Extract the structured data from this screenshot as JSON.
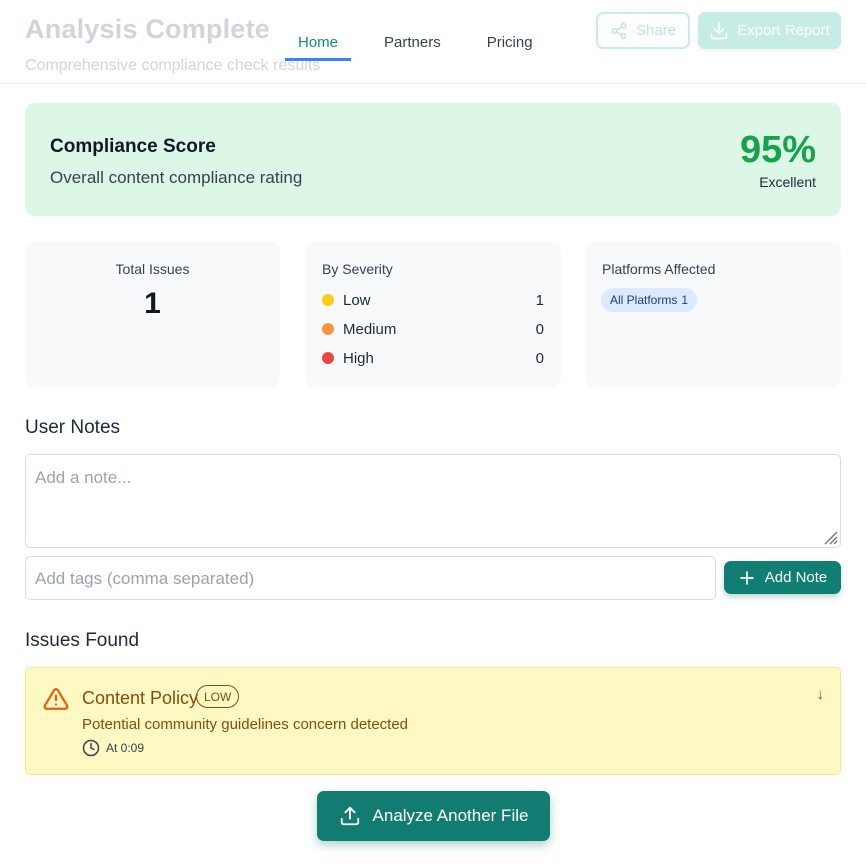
{
  "header": {
    "title": "Analysis Complete",
    "subtitle": "Comprehensive compliance check results",
    "nav": [
      {
        "label": "Home",
        "active": true
      },
      {
        "label": "Partners",
        "active": false
      },
      {
        "label": "Pricing",
        "active": false
      }
    ],
    "share_label": "Share",
    "share_icon": "share-icon",
    "export_label": "Export Report",
    "export_icon": "download-icon"
  },
  "score": {
    "title": "Compliance Score",
    "description": "Overall content compliance rating",
    "value": "95%",
    "rating": "Excellent"
  },
  "stats": {
    "total": {
      "label": "Total Issues",
      "value": "1"
    },
    "severity": {
      "label": "By Severity",
      "items": [
        {
          "name": "Low",
          "count": "1",
          "color": "#facc15"
        },
        {
          "name": "Medium",
          "count": "0",
          "color": "#fb923c"
        },
        {
          "name": "High",
          "count": "0",
          "color": "#ef4444"
        }
      ]
    },
    "platforms": {
      "label": "Platforms Affected",
      "badge_name": "All Platforms",
      "badge_count": "1"
    }
  },
  "notes": {
    "title": "User Notes",
    "note_placeholder": "Add a note...",
    "tags_placeholder": "Add tags (comma separated)",
    "add_label": "Add Note",
    "add_icon": "plus-icon"
  },
  "issues": {
    "title": "Issues Found",
    "items": [
      {
        "category": "Content Policy",
        "severity": "LOW",
        "description": "Potential community guidelines concern detected",
        "time": "At 0:09",
        "icon": "warning-icon",
        "expand": "↓"
      }
    ]
  },
  "footer": {
    "analyze_label": "Analyze Another File",
    "analyze_icon": "upload-icon"
  },
  "colors": {
    "accent": "#117e73",
    "score_green": "#16a34a",
    "issue_bg": "#fef9c3",
    "issue_text": "#854d0e"
  }
}
